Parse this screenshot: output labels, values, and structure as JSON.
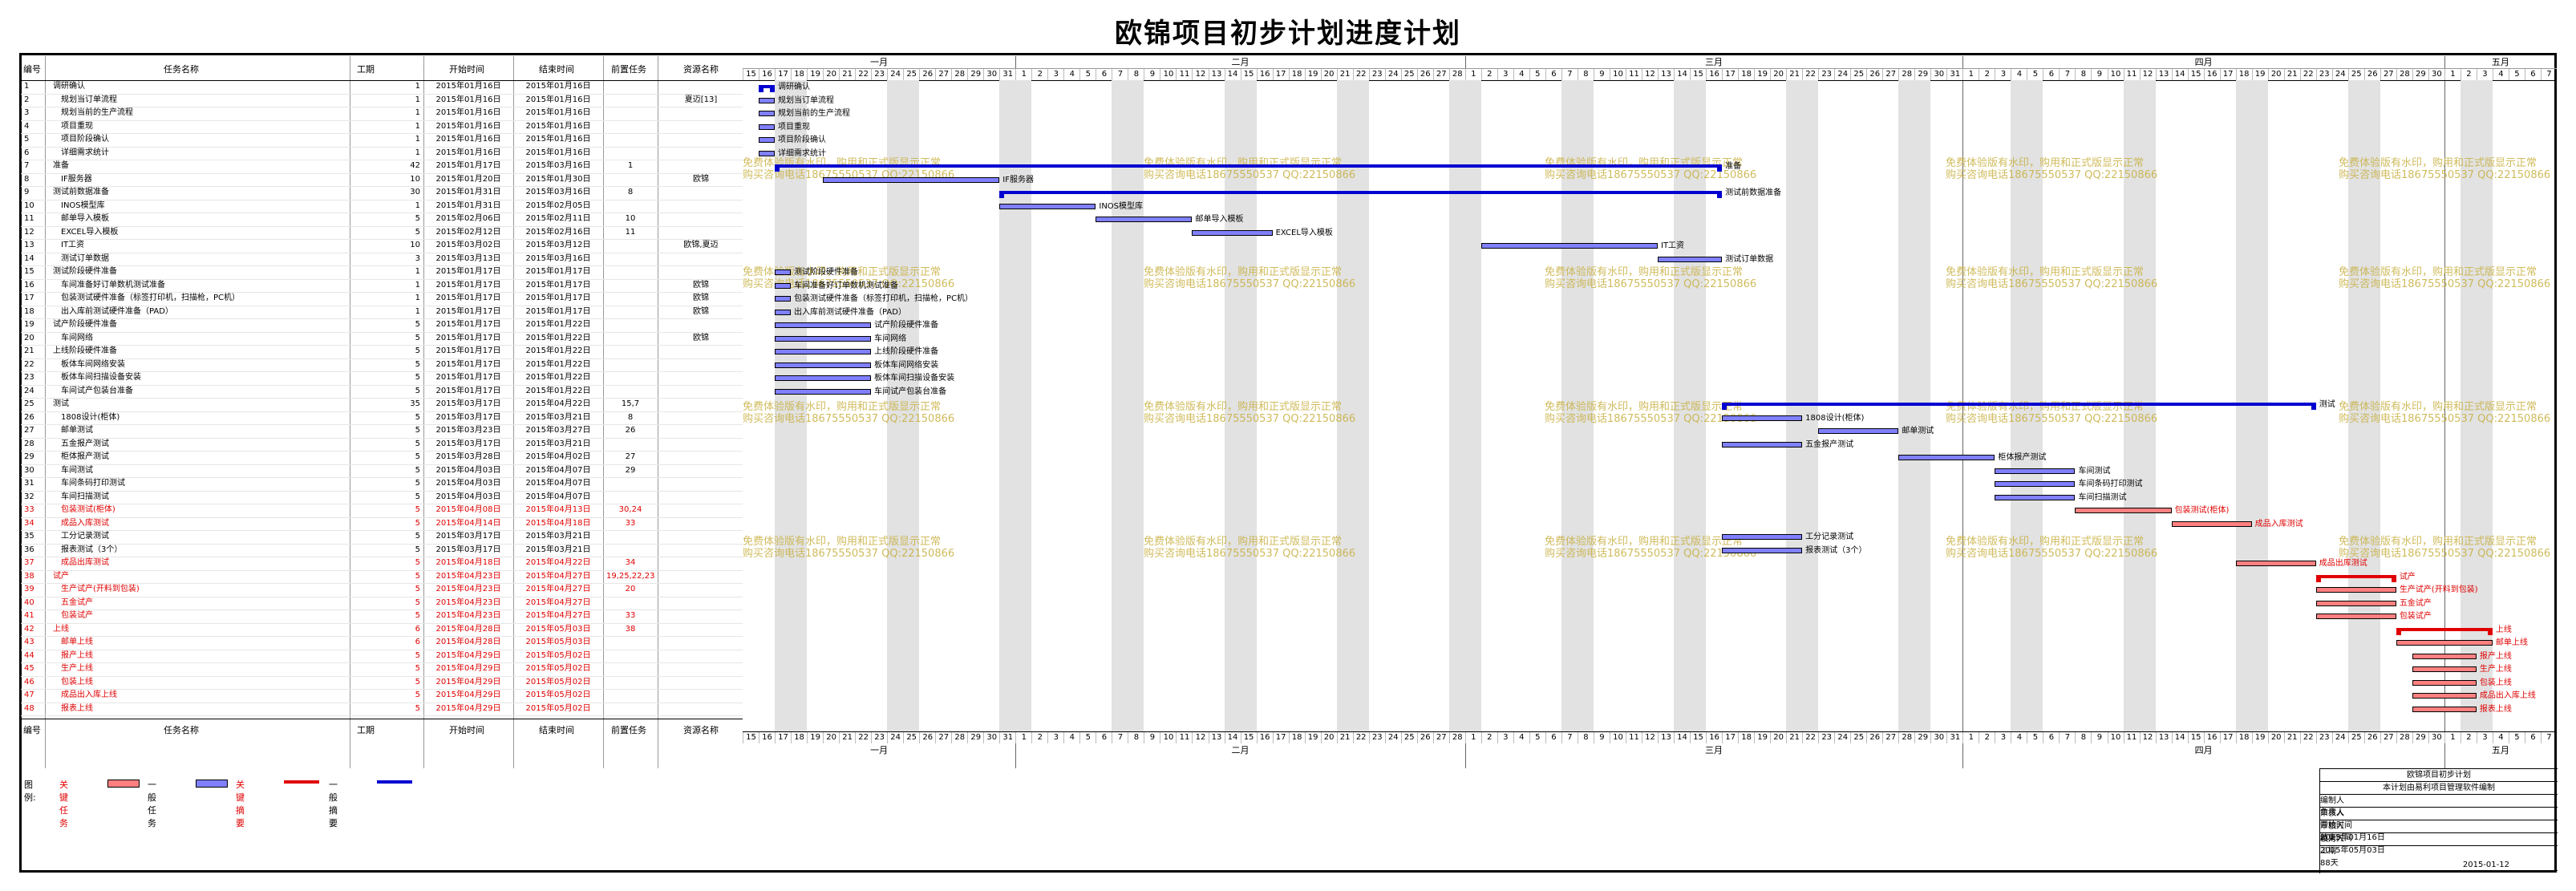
{
  "title": "欧锦项目初步计划进度计划",
  "columns": {
    "no": "编号",
    "name": "任务名称",
    "dur": "工期",
    "start": "开始时间",
    "end": "结束时间",
    "pred": "前置任务",
    "res": "资源名称"
  },
  "months": [
    {
      "label": "一月"
    },
    {
      "label": "二月"
    },
    {
      "label": "三月"
    },
    {
      "label": "四月"
    },
    {
      "label": "五月"
    }
  ],
  "days": [
    "15",
    "16",
    "17",
    "18",
    "19",
    "20",
    "21",
    "22",
    "23",
    "24",
    "25",
    "26",
    "27",
    "28",
    "29",
    "30",
    "31",
    "1",
    "2",
    "3",
    "4",
    "5",
    "6",
    "7",
    "8",
    "9",
    "10",
    "11",
    "12",
    "13",
    "14",
    "15",
    "16",
    "17",
    "18",
    "19",
    "20",
    "21",
    "22",
    "23",
    "24",
    "25",
    "26",
    "27",
    "28",
    "1",
    "2",
    "3",
    "4",
    "5",
    "6",
    "7",
    "8",
    "9",
    "10",
    "11",
    "12",
    "13",
    "14",
    "15",
    "16",
    "17",
    "18",
    "19",
    "20",
    "21",
    "22",
    "23",
    "24",
    "25",
    "26",
    "27",
    "28",
    "29",
    "30",
    "31",
    "1",
    "2",
    "3",
    "4",
    "5",
    "6",
    "7",
    "8",
    "9",
    "10",
    "11",
    "12",
    "13",
    "14",
    "15",
    "16",
    "17",
    "18",
    "19",
    "20",
    "21",
    "22",
    "23",
    "24",
    "25",
    "26",
    "27",
    "28",
    "29",
    "30",
    "1",
    "2",
    "3",
    "4",
    "5",
    "6",
    "7"
  ],
  "tasks": [
    {
      "no": "1",
      "name": "调研确认",
      "dur": "1",
      "start": "2015年01月16日",
      "end": "2015年01月16日",
      "pred": "",
      "res": "",
      "crit": false
    },
    {
      "no": "2",
      "name": "规划当订单流程",
      "dur": "1",
      "start": "2015年01月16日",
      "end": "2015年01月16日",
      "pred": "",
      "res": "夏迈[13]",
      "crit": false
    },
    {
      "no": "3",
      "name": "规划当前的生产流程",
      "dur": "1",
      "start": "2015年01月16日",
      "end": "2015年01月16日",
      "pred": "",
      "res": "",
      "crit": false
    },
    {
      "no": "4",
      "name": "项目重现",
      "dur": "1",
      "start": "2015年01月16日",
      "end": "2015年01月16日",
      "pred": "",
      "res": "",
      "crit": false
    },
    {
      "no": "5",
      "name": "项目阶段确认",
      "dur": "1",
      "start": "2015年01月16日",
      "end": "2015年01月16日",
      "pred": "",
      "res": "",
      "crit": false
    },
    {
      "no": "6",
      "name": "详细需求统计",
      "dur": "1",
      "start": "2015年01月16日",
      "end": "2015年01月16日",
      "pred": "",
      "res": "",
      "crit": false
    },
    {
      "no": "7",
      "name": "准备",
      "dur": "42",
      "start": "2015年01月17日",
      "end": "2015年03月16日",
      "pred": "1",
      "res": "",
      "crit": false
    },
    {
      "no": "8",
      "name": "IF服务器",
      "dur": "10",
      "start": "2015年01月20日",
      "end": "2015年01月30日",
      "pred": "",
      "res": "欧锦",
      "crit": false
    },
    {
      "no": "9",
      "name": "测试前数据准备",
      "dur": "30",
      "start": "2015年01月31日",
      "end": "2015年03月16日",
      "pred": "8",
      "res": "",
      "crit": false
    },
    {
      "no": "10",
      "name": "INOS模型库",
      "dur": "1",
      "start": "2015年01月31日",
      "end": "2015年02月05日",
      "pred": "",
      "res": "",
      "crit": false
    },
    {
      "no": "11",
      "name": "邮单导入模板",
      "dur": "5",
      "start": "2015年02月06日",
      "end": "2015年02月11日",
      "pred": "10",
      "res": "",
      "crit": false
    },
    {
      "no": "12",
      "name": "EXCEL导入模板",
      "dur": "5",
      "start": "2015年02月12日",
      "end": "2015年02月16日",
      "pred": "11",
      "res": "",
      "crit": false
    },
    {
      "no": "13",
      "name": "IT工资",
      "dur": "10",
      "start": "2015年03月02日",
      "end": "2015年03月12日",
      "pred": "",
      "res": "欧锦,夏迈",
      "crit": false
    },
    {
      "no": "14",
      "name": "测试订单数据",
      "dur": "3",
      "start": "2015年03月13日",
      "end": "2015年03月16日",
      "pred": "",
      "res": "",
      "crit": false
    },
    {
      "no": "15",
      "name": "测试阶段硬件准备",
      "dur": "1",
      "start": "2015年01月17日",
      "end": "2015年01月17日",
      "pred": "",
      "res": "",
      "crit": false
    },
    {
      "no": "16",
      "name": "车间准备好订单数机测试准备",
      "dur": "1",
      "start": "2015年01月17日",
      "end": "2015年01月17日",
      "pred": "",
      "res": "欧锦",
      "crit": false
    },
    {
      "no": "17",
      "name": "包装测试硬件准备（标签打印机，扫描枪，PC机）",
      "dur": "1",
      "start": "2015年01月17日",
      "end": "2015年01月17日",
      "pred": "",
      "res": "欧锦",
      "crit": false
    },
    {
      "no": "18",
      "name": "出入库前测试硬件准备（PAD）",
      "dur": "1",
      "start": "2015年01月17日",
      "end": "2015年01月17日",
      "pred": "",
      "res": "欧锦",
      "crit": false
    },
    {
      "no": "19",
      "name": "试产阶段硬件准备",
      "dur": "5",
      "start": "2015年01月17日",
      "end": "2015年01月22日",
      "pred": "",
      "res": "",
      "crit": false
    },
    {
      "no": "20",
      "name": "车间网络",
      "dur": "5",
      "start": "2015年01月17日",
      "end": "2015年01月22日",
      "pred": "",
      "res": "欧锦",
      "crit": false
    },
    {
      "no": "21",
      "name": "上线阶段硬件准备",
      "dur": "5",
      "start": "2015年01月17日",
      "end": "2015年01月22日",
      "pred": "",
      "res": "",
      "crit": false
    },
    {
      "no": "22",
      "name": "板体车间网络安装",
      "dur": "5",
      "start": "2015年01月17日",
      "end": "2015年01月22日",
      "pred": "",
      "res": "",
      "crit": false
    },
    {
      "no": "23",
      "name": "板体车间扫描设备安装",
      "dur": "5",
      "start": "2015年01月17日",
      "end": "2015年01月22日",
      "pred": "",
      "res": "",
      "crit": false
    },
    {
      "no": "24",
      "name": "车间试产包装台准备",
      "dur": "5",
      "start": "2015年01月17日",
      "end": "2015年01月22日",
      "pred": "",
      "res": "",
      "crit": false
    },
    {
      "no": "25",
      "name": "测试",
      "dur": "35",
      "start": "2015年03月17日",
      "end": "2015年04月22日",
      "pred": "15,7",
      "res": "",
      "crit": false
    },
    {
      "no": "26",
      "name": "1808设计(柜体)",
      "dur": "5",
      "start": "2015年03月17日",
      "end": "2015年03月21日",
      "pred": "8",
      "res": "",
      "crit": false
    },
    {
      "no": "27",
      "name": "邮单测试",
      "dur": "5",
      "start": "2015年03月23日",
      "end": "2015年03月27日",
      "pred": "26",
      "res": "",
      "crit": false
    },
    {
      "no": "28",
      "name": "五金报产测试",
      "dur": "5",
      "start": "2015年03月17日",
      "end": "2015年03月21日",
      "pred": "",
      "res": "",
      "crit": false
    },
    {
      "no": "29",
      "name": "柜体报产测试",
      "dur": "5",
      "start": "2015年03月28日",
      "end": "2015年04月02日",
      "pred": "27",
      "res": "",
      "crit": false
    },
    {
      "no": "30",
      "name": "车间测试",
      "dur": "5",
      "start": "2015年04月03日",
      "end": "2015年04月07日",
      "pred": "29",
      "res": "",
      "crit": false
    },
    {
      "no": "31",
      "name": "车间条码打印测试",
      "dur": "5",
      "start": "2015年04月03日",
      "end": "2015年04月07日",
      "pred": "",
      "res": "",
      "crit": false
    },
    {
      "no": "32",
      "name": "车间扫描测试",
      "dur": "5",
      "start": "2015年04月03日",
      "end": "2015年04月07日",
      "pred": "",
      "res": "",
      "crit": false
    },
    {
      "no": "33",
      "name": "包装测试(柜体)",
      "dur": "5",
      "start": "2015年04月08日",
      "end": "2015年04月13日",
      "pred": "30,24",
      "res": "",
      "crit": true
    },
    {
      "no": "34",
      "name": "成品入库测试",
      "dur": "5",
      "start": "2015年04月14日",
      "end": "2015年04月18日",
      "pred": "33",
      "res": "",
      "crit": true
    },
    {
      "no": "35",
      "name": "工分记录测试",
      "dur": "5",
      "start": "2015年03月17日",
      "end": "2015年03月21日",
      "pred": "",
      "res": "",
      "crit": false
    },
    {
      "no": "36",
      "name": "报表测试（3个）",
      "dur": "5",
      "start": "2015年03月17日",
      "end": "2015年03月21日",
      "pred": "",
      "res": "",
      "crit": false
    },
    {
      "no": "37",
      "name": "成品出库测试",
      "dur": "5",
      "start": "2015年04月18日",
      "end": "2015年04月22日",
      "pred": "34",
      "res": "",
      "crit": true
    },
    {
      "no": "38",
      "name": "试产",
      "dur": "5",
      "start": "2015年04月23日",
      "end": "2015年04月27日",
      "pred": "19,25,22,23",
      "res": "",
      "crit": true
    },
    {
      "no": "39",
      "name": "生产试产(开料到包装)",
      "dur": "5",
      "start": "2015年04月23日",
      "end": "2015年04月27日",
      "pred": "20",
      "res": "",
      "crit": true
    },
    {
      "no": "40",
      "name": "五金试产",
      "dur": "5",
      "start": "2015年04月23日",
      "end": "2015年04月27日",
      "pred": "",
      "res": "",
      "crit": true
    },
    {
      "no": "41",
      "name": "包装试产",
      "dur": "5",
      "start": "2015年04月23日",
      "end": "2015年04月27日",
      "pred": "33",
      "res": "",
      "crit": true
    },
    {
      "no": "42",
      "name": "上线",
      "dur": "6",
      "start": "2015年04月28日",
      "end": "2015年05月03日",
      "pred": "38",
      "res": "",
      "crit": true
    },
    {
      "no": "43",
      "name": "邮单上线",
      "dur": "6",
      "start": "2015年04月28日",
      "end": "2015年05月03日",
      "pred": "",
      "res": "",
      "crit": true
    },
    {
      "no": "44",
      "name": "报产上线",
      "dur": "5",
      "start": "2015年04月29日",
      "end": "2015年05月02日",
      "pred": "",
      "res": "",
      "crit": true
    },
    {
      "no": "45",
      "name": "生产上线",
      "dur": "5",
      "start": "2015年04月29日",
      "end": "2015年05月02日",
      "pred": "",
      "res": "",
      "crit": true
    },
    {
      "no": "46",
      "name": "包装上线",
      "dur": "5",
      "start": "2015年04月29日",
      "end": "2015年05月02日",
      "pred": "",
      "res": "",
      "crit": true
    },
    {
      "no": "47",
      "name": "成品出入库上线",
      "dur": "5",
      "start": "2015年04月29日",
      "end": "2015年05月02日",
      "pred": "",
      "res": "",
      "crit": true
    },
    {
      "no": "48",
      "name": "报表上线",
      "dur": "5",
      "start": "2015年04月29日",
      "end": "2015年05月02日",
      "pred": "",
      "res": "",
      "crit": true
    }
  ],
  "watermark": {
    "line1": "免费体验版有水印，购用和正式版显示正常",
    "line2": "购买咨询电话18675550537 QQ:22150866"
  },
  "legend": {
    "prefix": "图例:",
    "crit_task": "关键任务",
    "gen_task": "一般任务",
    "crit_summary": "关键摘要",
    "gen_summary": "一般摘要"
  },
  "infobox": {
    "title": "欧锦项目初步计划",
    "subtitle": "本计划由易利项目管理软件编制",
    "rows": [
      {
        "k": "编制人",
        "v": "",
        "k2": "负责人",
        "v2": ""
      },
      {
        "k": "审核人",
        "v": "",
        "k2": "开始时间",
        "v2": "2015年01月16日"
      },
      {
        "k": "审核人",
        "v": "",
        "k2": "结束时间",
        "v2": "2015年05月03日"
      },
      {
        "k": "校对人",
        "v": "",
        "k2": "工期",
        "v2": "88天"
      }
    ],
    "date": "2015-01-12"
  },
  "colors": {
    "critical": "#ff8080",
    "general": "#8080ff",
    "summary": "#0000d0",
    "critical_text": "#e00000"
  }
}
